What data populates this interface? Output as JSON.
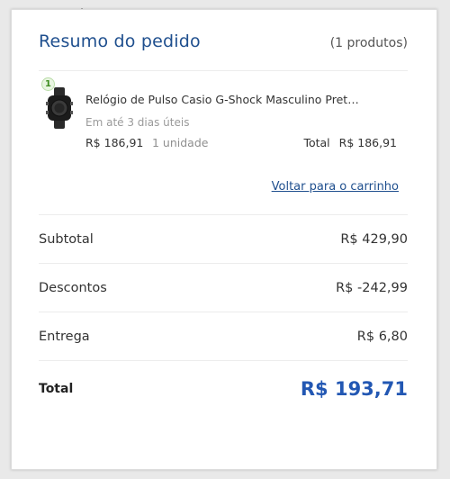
{
  "header": {
    "title": "Resumo do pedido",
    "count": "(1 produtos)"
  },
  "item": {
    "quantity_badge": "1",
    "name": "Relógio de Pulso Casio G-Shock Masculino Pret…",
    "delivery": "Em até 3 dias úteis",
    "unit_price": "R$ 186,91",
    "units": "1 unidade",
    "total_label": "Total",
    "total_value": "R$ 186,91",
    "image_icon": "watch-icon"
  },
  "back_link": "Voltar para o carrinho",
  "summary": {
    "subtotal_label": "Subtotal",
    "subtotal_value": "R$ 429,90",
    "discounts_label": "Descontos",
    "discounts_value": "R$ -242,99",
    "shipping_label": "Entrega",
    "shipping_value": "R$ 6,80",
    "total_label": "Total",
    "total_value": "R$ 193,71"
  },
  "colors": {
    "accent": "#1f4f8e",
    "total_accent": "#2257b3",
    "badge_green": "#3d8c1f"
  }
}
